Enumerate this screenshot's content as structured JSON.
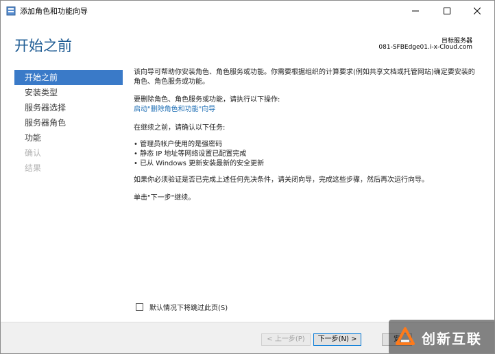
{
  "window": {
    "title": "添加角色和功能向导"
  },
  "header": {
    "title": "开始之前",
    "target_server_label": "目标服务器",
    "target_server_name": "081-SFBEdge01.i-x-Cloud.com"
  },
  "nav": {
    "items": [
      {
        "label": "开始之前",
        "state": "active"
      },
      {
        "label": "安装类型",
        "state": "normal"
      },
      {
        "label": "服务器选择",
        "state": "normal"
      },
      {
        "label": "服务器角色",
        "state": "normal"
      },
      {
        "label": "功能",
        "state": "normal"
      },
      {
        "label": "确认",
        "state": "disabled"
      },
      {
        "label": "结果",
        "state": "disabled"
      }
    ]
  },
  "content": {
    "intro": "该向导可帮助你安装角色、角色服务或功能。你需要根据组织的计算要求(例如共享文档或托管网站)确定要安装的角色、角色服务或功能。",
    "remove_text": "要删除角色、角色服务或功能，请执行以下操作:",
    "remove_link": "启动\"删除角色和功能\"向导",
    "before_text": "在继续之前，请确认以下任务:",
    "tasks": [
      "管理员帐户使用的是强密码",
      "静态 IP 地址等网络设置已配置完成",
      "已从 Windows 更新安装最新的安全更新"
    ],
    "verify_text": "如果你必须验证是否已完成上述任何先决条件，请关闭向导，完成这些步骤，然后再次运行向导。",
    "next_text": "单击\"下一步\"继续。"
  },
  "skip_checkbox": {
    "label": "默认情况下将跳过此页(S)",
    "checked": false
  },
  "footer": {
    "prev_label": "< 上一步(P)",
    "next_label": "下一步(N) >",
    "partial_label": "安"
  },
  "watermark": {
    "text": "创新互联"
  },
  "colors": {
    "accent": "#1f5c94",
    "nav_active_bg": "#3a7ac8",
    "link": "#1f6fb5"
  }
}
